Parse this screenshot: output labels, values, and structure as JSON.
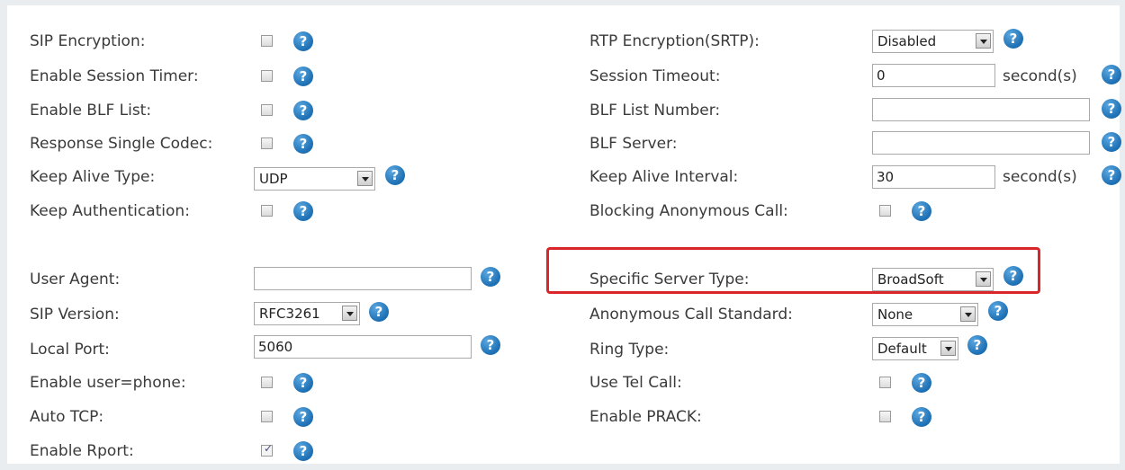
{
  "left": {
    "sip_encryption": "SIP Encryption:",
    "enable_session_timer": "Enable Session Timer:",
    "enable_blf_list": "Enable BLF List:",
    "response_single_codec": "Response Single Codec:",
    "keep_alive_type": "Keep Alive Type:",
    "keep_alive_type_value": "UDP",
    "keep_authentication": "Keep Authentication:",
    "user_agent": "User Agent:",
    "user_agent_value": "",
    "sip_version": "SIP Version:",
    "sip_version_value": "RFC3261",
    "local_port": "Local Port:",
    "local_port_value": "5060",
    "enable_user_phone": "Enable user=phone:",
    "auto_tcp": "Auto TCP:",
    "enable_rport": "Enable Rport:"
  },
  "right": {
    "rtp_encryption": "RTP Encryption(SRTP):",
    "rtp_encryption_value": "Disabled",
    "session_timeout": "Session Timeout:",
    "session_timeout_value": "0",
    "blf_list_number": "BLF List Number:",
    "blf_list_number_value": "",
    "blf_server": "BLF Server:",
    "blf_server_value": "",
    "keep_alive_interval": "Keep Alive Interval:",
    "keep_alive_interval_value": "30",
    "blocking_anonymous_call": "Blocking Anonymous Call:",
    "specific_server_type": "Specific Server Type:",
    "specific_server_type_value": "BroadSoft",
    "anonymous_call_standard": "Anonymous Call Standard:",
    "anonymous_call_standard_value": "None",
    "ring_type": "Ring Type:",
    "ring_type_value": "Default",
    "use_tel_call": "Use Tel Call:",
    "enable_prack": "Enable PRACK:"
  },
  "units": {
    "seconds": "second(s)"
  },
  "help_glyph": "?",
  "checkboxes": {
    "enable_rport": true
  },
  "colors": {
    "help": "#1d6fb3",
    "highlight": "#d9262a"
  }
}
